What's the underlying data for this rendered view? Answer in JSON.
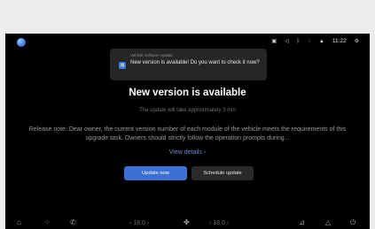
{
  "status_bar": {
    "icons": [
      "photo-icon",
      "volume-icon",
      "bluetooth-icon",
      "wifi-icon",
      "signal-icon",
      "time",
      "settings-icon"
    ],
    "signal": "",
    "time": "11:22"
  },
  "notification": {
    "title": "Vehicle software update",
    "message": "New version is available! Do you want to check it now?"
  },
  "main": {
    "headline": "New version is available",
    "subline": "The update will take approximately 3 min",
    "release_note": "Release note: Dear owner, the current version number of each module of the vehicle meets the requirements of this upgrade task. Owners should strictly follow the operation prompts during...",
    "view_details": "View details ›"
  },
  "buttons": {
    "update_now": "Update now",
    "schedule_update": "Schedule update"
  },
  "dock": {
    "left_temp": "‹ 18.0 ›",
    "right_temp": "‹ 18.0 ›"
  },
  "colors": {
    "accent": "#3b6fd2",
    "screen_bg": "#000000",
    "link": "#6a8cc9"
  }
}
